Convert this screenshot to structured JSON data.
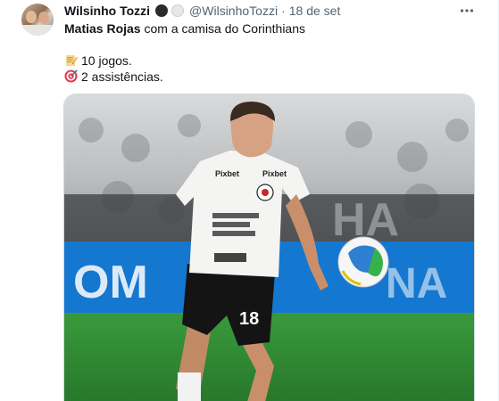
{
  "tweet": {
    "author_name": "Wilsinho Tozzi",
    "handle": "@WilsinhoTozzi",
    "separator": "·",
    "date": "18 de set",
    "more_icon": "more-horizontal-icon",
    "text": {
      "mention": "Matias Rojas",
      "rest": " com a camisa do Corinthians",
      "line2_emoji": "memo-emoji",
      "line2_text": "10 jogos.",
      "line3_emoji": "direct-hit-emoji",
      "line3_text": "2 assistências."
    },
    "media": {
      "kind": "photo",
      "jersey_number": "18",
      "jersey_sponsor": "Pixbet",
      "colors": {
        "pitch": "#2f8a33",
        "board": "#1477d0",
        "shirt": "#f4f4f2",
        "shorts": "#141414"
      }
    }
  }
}
